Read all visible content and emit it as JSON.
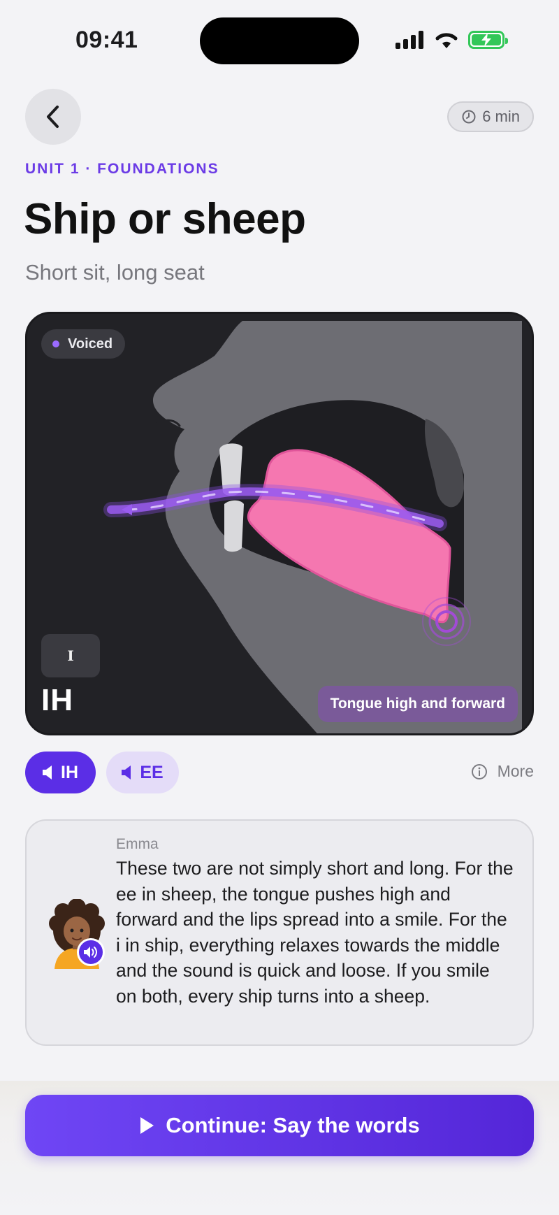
{
  "status_bar": {
    "time": "09:41"
  },
  "header": {
    "back_icon": "chevron-left-icon",
    "duration": "6 min"
  },
  "lesson": {
    "unit_label": "UNIT 1 · FOUNDATIONS",
    "title": "Ship or sheep",
    "subtitle": "Short sit, long seat"
  },
  "diagram": {
    "voiced_label": "Voiced",
    "ipa_symbol": "I",
    "sound_code": "IH",
    "caption": "Tongue high and forward",
    "colors": {
      "tongue": "#f577b0",
      "airflow": "#8a4ee6",
      "head": "#6d6d73"
    }
  },
  "sound_chips": [
    {
      "label": "IH",
      "icon": "speaker-icon",
      "active": true
    },
    {
      "label": "EE",
      "icon": "speaker-icon",
      "active": false
    }
  ],
  "more": {
    "label": "More",
    "icon": "info-icon"
  },
  "tutor": {
    "name": "Emma",
    "message": "These two are not simply short and long. For the ee in sheep, the tongue pushes high and forward and the lips spread into a smile. For the i in ship, everything relaxes towards the middle and the sound is quick and loose. If you smile on both, every ship turns into a sheep."
  },
  "cta": {
    "label": "Continue: Say the words",
    "icon": "play-icon"
  },
  "colors": {
    "accent": "#5b2ee6",
    "accent_light": "#e4dcf8",
    "background": "#f3f3f6"
  }
}
